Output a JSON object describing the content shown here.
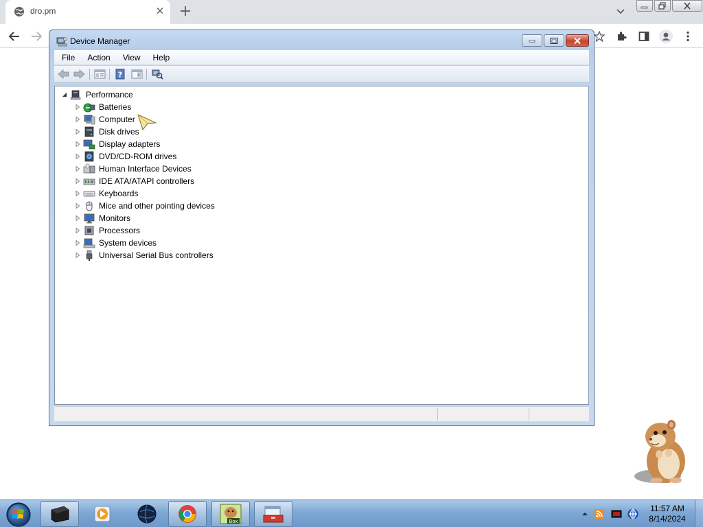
{
  "browser": {
    "tab_title": "dro.pm",
    "tab_close_glyph": "✕",
    "new_tab_glyph": "+"
  },
  "window": {
    "title": "Device Manager",
    "menu": [
      "File",
      "Action",
      "View",
      "Help"
    ]
  },
  "tree": {
    "root": "Performance",
    "items": [
      {
        "label": "Batteries",
        "icon": "battery-icon"
      },
      {
        "label": "Computer",
        "icon": "computer-icon"
      },
      {
        "label": "Disk drives",
        "icon": "disk-drive-icon"
      },
      {
        "label": "Display adapters",
        "icon": "display-adapter-icon"
      },
      {
        "label": "DVD/CD-ROM drives",
        "icon": "dvd-drive-icon"
      },
      {
        "label": "Human Interface Devices",
        "icon": "hid-icon"
      },
      {
        "label": "IDE ATA/ATAPI controllers",
        "icon": "ide-controller-icon"
      },
      {
        "label": "Keyboards",
        "icon": "keyboard-icon"
      },
      {
        "label": "Mice and other pointing devices",
        "icon": "mouse-icon"
      },
      {
        "label": "Monitors",
        "icon": "monitor-icon"
      },
      {
        "label": "Processors",
        "icon": "processor-icon"
      },
      {
        "label": "System devices",
        "icon": "system-devices-icon"
      },
      {
        "label": "Universal Serial Bus controllers",
        "icon": "usb-icon"
      }
    ]
  },
  "taskbar": {
    "clock_time": "11:57 AM",
    "clock_date": "8/14/2024",
    "app_label": "Box"
  },
  "colors": {
    "title_bar": "#bcd3ec",
    "taskbar": "#7ea7d4",
    "close_button": "#c7432e"
  }
}
